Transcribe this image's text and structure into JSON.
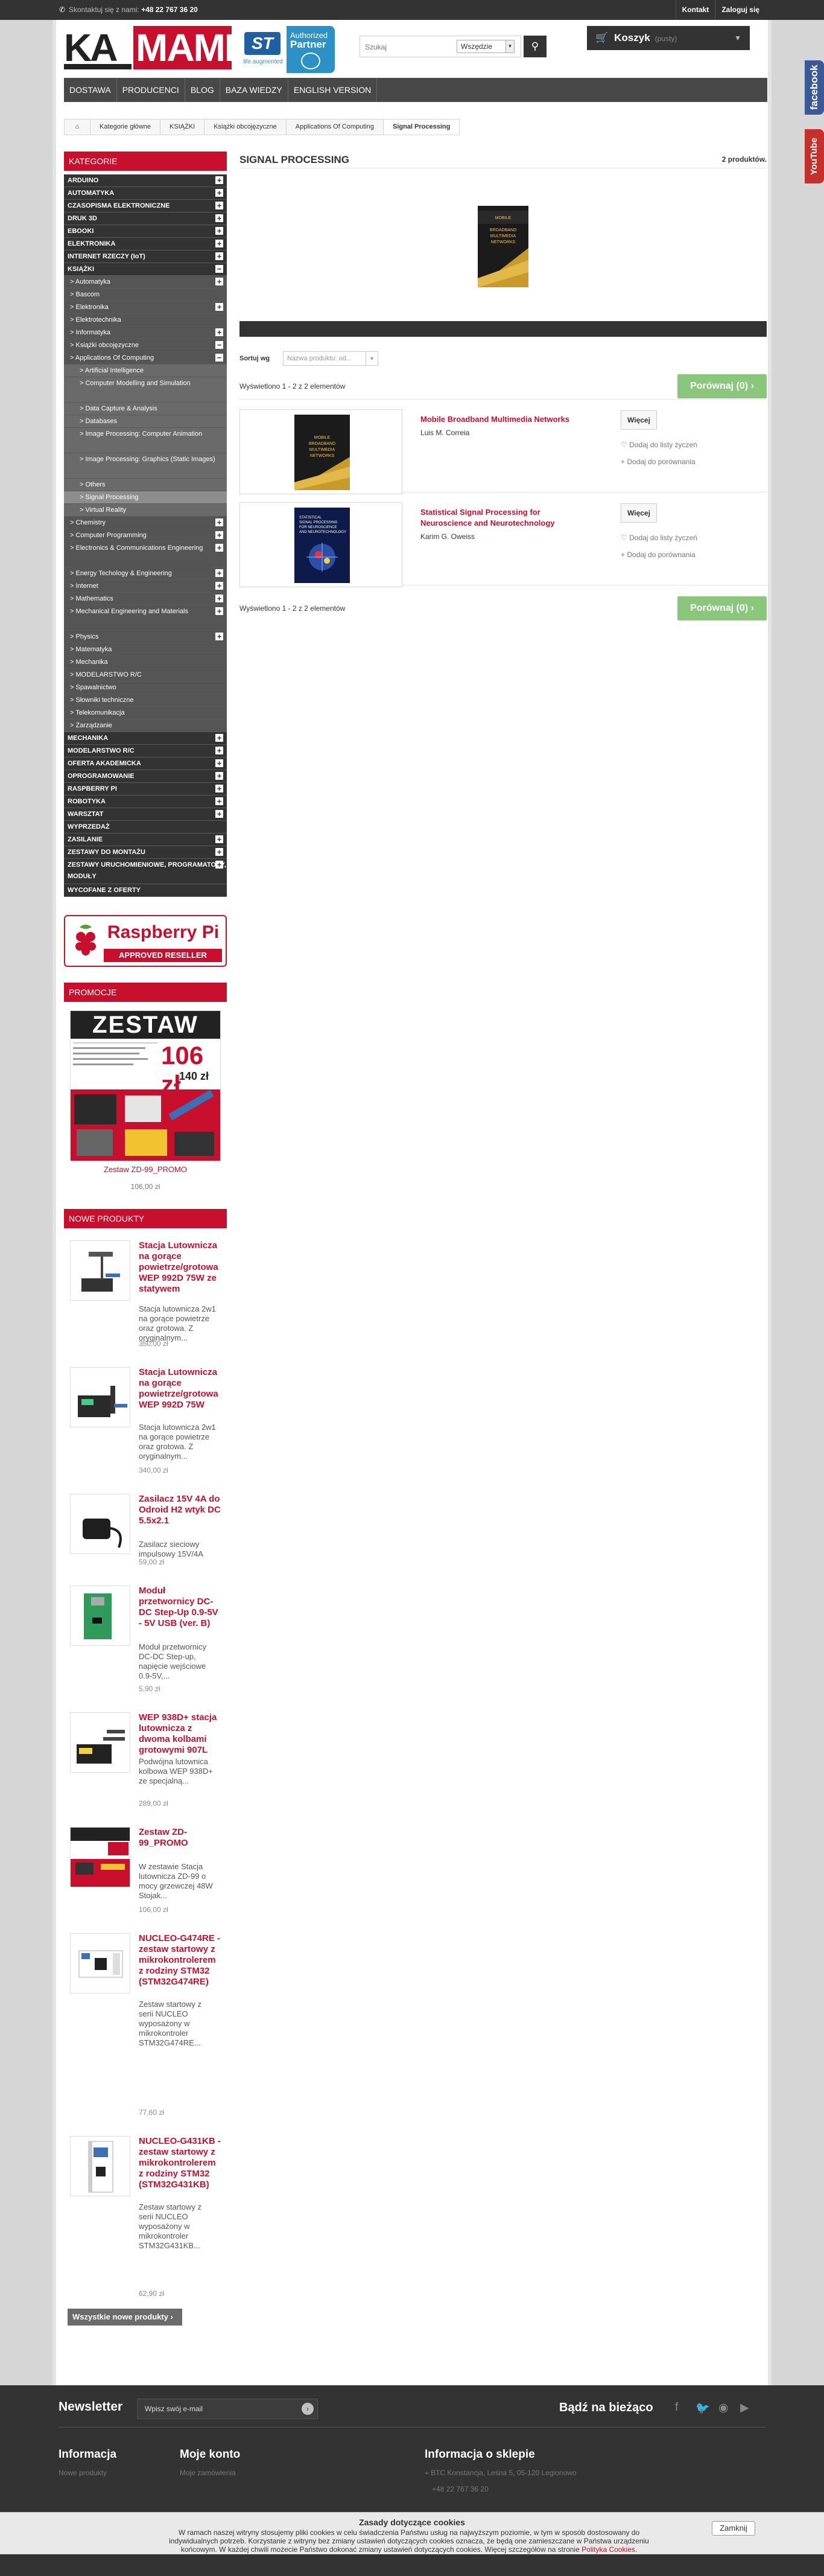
{
  "topbar": {
    "phone_prefix": "Skontaktuj się z nami: ",
    "phone_number": "+48 22 767 36 20",
    "links": [
      "Kontakt",
      "Zaloguj się"
    ]
  },
  "header": {
    "logo_ka": "KA",
    "logo_mami": "MAMI",
    "st_logo": "ST",
    "st_sub": "life.augmented",
    "st_authorized": "Authorized",
    "st_partner": "Partner",
    "search_placeholder": "Szukaj",
    "search_category": "Wszędzie",
    "cart_label": "Koszyk",
    "cart_status": "(pusty)"
  },
  "nav": [
    "DOSTAWA",
    "PRODUCENCI",
    "BLOG",
    "BAZA WIEDZY",
    "ENGLISH VERSION"
  ],
  "breadcrumb": [
    "Kategorie główne",
    "KSIĄŻKI",
    "Książki obcojęzyczne",
    "Applications Of Computing",
    "Signal Processing"
  ],
  "sidebar": {
    "categories_title": "KATEGORIE",
    "categories": [
      {
        "label": "ARDUINO",
        "level": 0,
        "sign": "+"
      },
      {
        "label": "AUTOMATYKA",
        "level": 0,
        "sign": "+"
      },
      {
        "label": "CZASOPISMA ELEKTRONICZNE",
        "level": 0,
        "sign": "+"
      },
      {
        "label": "DRUK 3D",
        "level": 0,
        "sign": "+"
      },
      {
        "label": "EBOOKI",
        "level": 0,
        "sign": "+"
      },
      {
        "label": "ELEKTRONIKA",
        "level": 0,
        "sign": "+"
      },
      {
        "label": "INTERNET RZECZY (IoT)",
        "level": 0,
        "sign": "+"
      },
      {
        "label": "KSIĄŻKI",
        "level": 0,
        "sign": "−"
      },
      {
        "label": "> Automatyka",
        "level": 1,
        "sign": "+"
      },
      {
        "label": "> Bascom",
        "level": 1,
        "sign": ""
      },
      {
        "label": "> Elektronika",
        "level": 1,
        "sign": "+"
      },
      {
        "label": "> Elektrotechnika",
        "level": 1,
        "sign": ""
      },
      {
        "label": "> Informatyka",
        "level": 1,
        "sign": "+"
      },
      {
        "label": "> Książki obcojęzyczne",
        "level": 1,
        "sign": "−"
      },
      {
        "label": "> Applications Of Computing",
        "level": 1,
        "sign": "−"
      },
      {
        "label": "> Artificial Intelligence",
        "level": 2,
        "sign": ""
      },
      {
        "label": "> Computer Modelling and Simulation",
        "level": 2,
        "sign": "",
        "tall": true
      },
      {
        "label": "> Data Capture & Analysis",
        "level": 2,
        "sign": ""
      },
      {
        "label": "> Databases",
        "level": 2,
        "sign": ""
      },
      {
        "label": "> Image Processing: Computer Animation",
        "level": 2,
        "sign": "",
        "tall": true
      },
      {
        "label": "> Image Processing: Graphics (Static Images)",
        "level": 2,
        "sign": "",
        "tall": true
      },
      {
        "label": "> Others",
        "level": 2,
        "sign": ""
      },
      {
        "label": "> Signal Processing",
        "level": 2,
        "sign": "",
        "selected": true
      },
      {
        "label": "> Virtual Reality",
        "level": 2,
        "sign": ""
      },
      {
        "label": "> Chemistry",
        "level": 1,
        "sign": "+"
      },
      {
        "label": "> Computer Programming",
        "level": 1,
        "sign": "+"
      },
      {
        "label": "> Electronics & Communications Engineering",
        "level": 1,
        "sign": "+",
        "tall": true
      },
      {
        "label": "> Energy Techology & Engineering",
        "level": 1,
        "sign": "+"
      },
      {
        "label": "> Internet",
        "level": 1,
        "sign": "+"
      },
      {
        "label": "> Mathematics",
        "level": 1,
        "sign": "+"
      },
      {
        "label": "> Mechanical Engineering and Materials",
        "level": 1,
        "sign": "+",
        "tall": true
      },
      {
        "label": "> Physics",
        "level": 1,
        "sign": "+"
      },
      {
        "label": "> Matematyka",
        "level": 1,
        "sign": ""
      },
      {
        "label": "> Mechanika",
        "level": 1,
        "sign": ""
      },
      {
        "label": "> MODELARSTWO R/C",
        "level": 1,
        "sign": ""
      },
      {
        "label": "> Spawalnictwo",
        "level": 1,
        "sign": ""
      },
      {
        "label": "> Słowniki techniczne",
        "level": 1,
        "sign": ""
      },
      {
        "label": "> Telekomunikacja",
        "level": 1,
        "sign": ""
      },
      {
        "label": "> Zarządzanie",
        "level": 1,
        "sign": ""
      },
      {
        "label": "MECHANIKA",
        "level": 0,
        "sign": "+"
      },
      {
        "label": "MODELARSTWO R/C",
        "level": 0,
        "sign": "+"
      },
      {
        "label": "OFERTA AKADEMICKA",
        "level": 0,
        "sign": "+"
      },
      {
        "label": "OPROGRAMOWANIE",
        "level": 0,
        "sign": "+"
      },
      {
        "label": "RASPBERRY PI",
        "level": 0,
        "sign": "+"
      },
      {
        "label": "ROBOTYKA",
        "level": 0,
        "sign": "+"
      },
      {
        "label": "WARSZTAT",
        "level": 0,
        "sign": "+"
      },
      {
        "label": "WYPRZEDAŻ",
        "level": 0,
        "sign": ""
      },
      {
        "label": "ZASILANIE",
        "level": 0,
        "sign": "+"
      },
      {
        "label": "ZESTAWY DO MONTAŻU",
        "level": 0,
        "sign": "+"
      },
      {
        "label": "ZESTAWY URUCHOMIENIOWE, PROGRAMATORY, MODUŁY",
        "level": 0,
        "sign": "+",
        "tall": true
      },
      {
        "label": "WYCOFANE Z OFERTY",
        "level": 0,
        "sign": ""
      }
    ],
    "rpi_title": "Raspberry Pi",
    "rpi_sub": "APPROVED RESELLER",
    "promo_title": "PROMOCJE",
    "promo_img_title": "ZESTAW",
    "promo_img_price": "106 zł",
    "promo_img_price2": "140 zł",
    "promo_name": "Zestaw ZD-99_PROMO",
    "promo_price": "106,00 zł",
    "new_title": "NOWE PRODUKTY",
    "new_products": [
      {
        "name": "Stacja Lutownicza na gorące powietrze/grotowa WEP 992D 75W ze statywem",
        "desc": "Stacja lutownicza 2w1 na gorące powietrze oraz grotowa. Z oryginalnym...",
        "price": "350,00 zł"
      },
      {
        "name": "Stacja Lutownicza na gorące powietrze/grotowa WEP 992D 75W",
        "desc": "Stacja lutownicza 2w1 na gorące powietrze oraz grotowa. Z oryginalnym...",
        "price": "340,00 zł"
      },
      {
        "name": "Zasilacz 15V 4A do Odroid H2 wtyk DC 5.5x2.1",
        "desc": "Zasilacz sieciowy impulsowy 15V/4A",
        "price": "59,00 zł"
      },
      {
        "name": "Moduł przetwornicy DC-DC Step-Up 0.9-5V - 5V USB (ver. B)",
        "desc": "Moduł przetwornicy DC-DC Step-up, napięcie wejściowe 0.9-5V,...",
        "price": "5,90 zł"
      },
      {
        "name": "WEP 938D+ stacja lutownicza z dwoma kolbami grotowymi 907L",
        "desc": "Podwójna lutownica kolbowa WEP 938D+ ze specjalną...",
        "price": "289,00 zł"
      },
      {
        "name": "Zestaw ZD-99_PROMO",
        "desc": "W zestawie Stacja lutownicza ZD-99 o mocy grzewczej 48W Stojak...",
        "price": "106,00 zł"
      },
      {
        "name": "NUCLEO-G474RE - zestaw startowy z mikrokontrolerem z rodziny STM32 (STM32G474RE)",
        "desc": "Zestaw startowy z serii NUCLEO wyposażony w mikrokontroler STM32G474RE...",
        "price": "77,60 zł"
      },
      {
        "name": "NUCLEO-G431KB - zestaw startowy z mikrokontrolerem z rodziny STM32 (STM32G431KB)",
        "desc": "Zestaw startowy z serii NUCLEO wyposażony w mikrokontroler STM32G431KB...",
        "price": "62,90 zł"
      }
    ],
    "all_new": "Wszystkie nowe produkty"
  },
  "content": {
    "title": "SIGNAL PROCESSING",
    "count": "2 produktów.",
    "sort_label": "Sortuj wg",
    "sort_value": "Nazwa produktu: od...",
    "showing": "Wyświetlono 1 - 2 z 2 elementów",
    "compare": "Porównaj (0)",
    "more": "Więcej",
    "wishlist": "Dodaj do listy życzeń",
    "add_compare": "Dodaj do porównania",
    "products": [
      {
        "title": "Mobile Broadband Multimedia Networks",
        "author": "Luis M. Correia"
      },
      {
        "title": "Statistical Signal Processing for Neuroscience and Neurotechnology",
        "author": "Karim G. Oweiss"
      }
    ]
  },
  "social": [
    "facebook",
    "YouTube"
  ],
  "footer": {
    "newsletter": "Newsletter",
    "email_placeholder": "Wpisz swój e-mail",
    "follow": "Bądź na bieżąco",
    "info_title": "Informacja",
    "info_items": [
      "Nowe produkty"
    ],
    "account_title": "Moje konto",
    "account_items": [
      "Moje zamówienia"
    ],
    "store_title": "Informacja o sklepie",
    "store_items": [
      "BTC Konstancja, Leśna 5, 05-120 Legionowo",
      "+48 22 767 36 20"
    ]
  },
  "cookie": {
    "title": "Zasady dotyczące cookies",
    "body": "W ramach naszej witryny stosujemy pliki cookies w celu świadczenia Państwu usług na najwyższym poziomie, w tym w sposób dostosowany do indywidualnych potrzeb. Korzystanie z witryny bez zmiany ustawień dotyczących cookies oznacza, że będą one zamieszczane w Państwa urządzeniu końcowym. W każdej chwili możecie Państwo dokonać zmiany ustawień dotyczących cookies. Więcej szczegółów na stronie ",
    "link": "Polityka Cookies",
    "close": "Zamknij"
  },
  "colors": {
    "brand_red": "#c8102e",
    "dark": "#333333",
    "green": "#8ac77d"
  }
}
